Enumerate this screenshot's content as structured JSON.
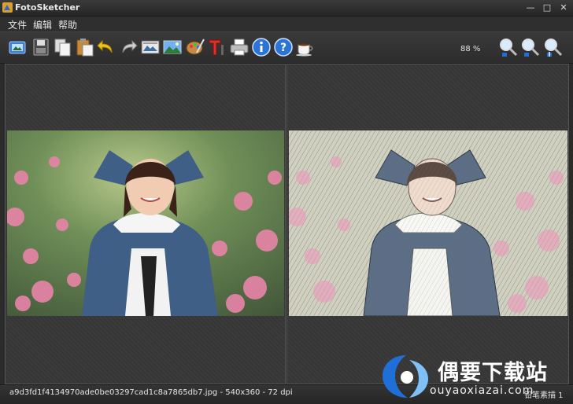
{
  "window": {
    "title": "FotoSketcher",
    "minimize_glyph": "—",
    "maximize_glyph": "□",
    "close_glyph": "✕"
  },
  "menu": {
    "items": [
      "文件",
      "编辑",
      "帮助"
    ]
  },
  "toolbar": {
    "buttons": [
      {
        "name": "open-image",
        "icon": "open-image-icon"
      },
      {
        "name": "save",
        "icon": "save-icon"
      },
      {
        "name": "copy",
        "icon": "copy-icon"
      },
      {
        "name": "paste",
        "icon": "paste-icon"
      },
      {
        "name": "undo",
        "icon": "undo-icon"
      },
      {
        "name": "redo",
        "icon": "redo-icon"
      },
      {
        "name": "drawing-parameters",
        "icon": "filter-image-icon"
      },
      {
        "name": "process-image",
        "icon": "landscape-image-icon"
      },
      {
        "name": "palette",
        "icon": "palette-icon"
      },
      {
        "name": "add-text",
        "icon": "text-tool-icon"
      },
      {
        "name": "print",
        "icon": "printer-icon"
      },
      {
        "name": "info",
        "icon": "info-icon"
      },
      {
        "name": "help",
        "icon": "help-icon"
      },
      {
        "name": "donate",
        "icon": "coffee-cup-icon"
      }
    ],
    "zoom_level": "88 %",
    "zoom_buttons": [
      {
        "name": "zoom-out",
        "icon": "zoom-out-icon"
      },
      {
        "name": "zoom-fit",
        "icon": "zoom-fit-icon"
      },
      {
        "name": "zoom-in",
        "icon": "zoom-in-icon"
      }
    ]
  },
  "status": {
    "file_info": "a9d3fd1f4134970ade0be03297cad1c8a7865db7.jpg - 540x360 - 72 dpi",
    "right_info": "铅笔素描 1"
  },
  "watermark": {
    "brand": "偶要下载站",
    "domain": "ouyaoxiazai.com"
  },
  "colors": {
    "window_bg": "#2b2b2b",
    "toolbar_bg": "#333333",
    "panel_border": "#555555",
    "accent_blue": "#1f6fd6"
  }
}
